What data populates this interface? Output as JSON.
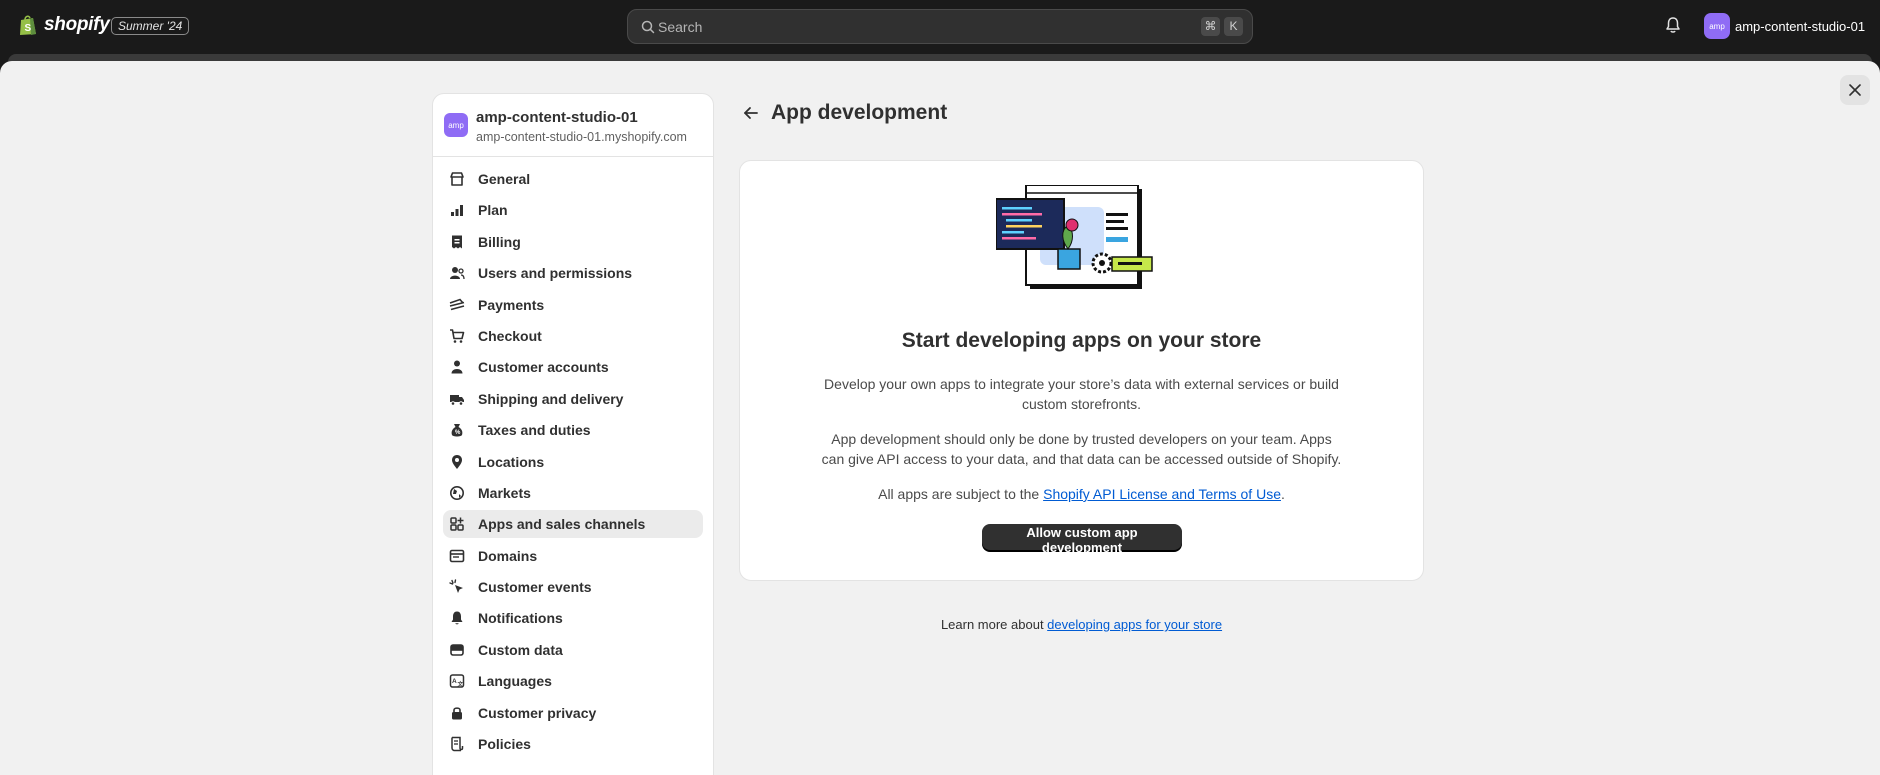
{
  "topbar": {
    "logo_text": "shopify",
    "edition_badge": "Summer '24",
    "search_placeholder": "Search",
    "shortcut_key1": "⌘",
    "shortcut_key2": "K",
    "account_avatar": "amp",
    "account_name": "amp-content-studio-01"
  },
  "sidebar": {
    "store_avatar": "amp",
    "store_name": "amp-content-studio-01",
    "store_domain": "amp-content-studio-01.myshopify.com",
    "items": [
      {
        "label": "General",
        "icon": "store-icon"
      },
      {
        "label": "Plan",
        "icon": "plan-icon"
      },
      {
        "label": "Billing",
        "icon": "billing-icon"
      },
      {
        "label": "Users and permissions",
        "icon": "users-icon"
      },
      {
        "label": "Payments",
        "icon": "payments-icon"
      },
      {
        "label": "Checkout",
        "icon": "cart-icon"
      },
      {
        "label": "Customer accounts",
        "icon": "person-icon"
      },
      {
        "label": "Shipping and delivery",
        "icon": "truck-icon"
      },
      {
        "label": "Taxes and duties",
        "icon": "tax-icon"
      },
      {
        "label": "Locations",
        "icon": "location-pin-icon"
      },
      {
        "label": "Markets",
        "icon": "globe-icon"
      },
      {
        "label": "Apps and sales channels",
        "icon": "apps-icon",
        "active": true
      },
      {
        "label": "Domains",
        "icon": "domain-icon"
      },
      {
        "label": "Customer events",
        "icon": "cursor-icon"
      },
      {
        "label": "Notifications",
        "icon": "bell-icon"
      },
      {
        "label": "Custom data",
        "icon": "database-icon"
      },
      {
        "label": "Languages",
        "icon": "language-icon"
      },
      {
        "label": "Customer privacy",
        "icon": "lock-icon"
      },
      {
        "label": "Policies",
        "icon": "policy-icon"
      }
    ]
  },
  "main": {
    "page_title": "App development",
    "card": {
      "heading": "Start developing apps on your store",
      "paragraph1": "Develop your own apps to integrate your store’s data with external services or build custom storefronts.",
      "paragraph2": "App development should only be done by trusted developers on your team. Apps can give API access to your data, and that data can be accessed outside of Shopify.",
      "terms_prefix": "All apps are subject to the ",
      "terms_link": "Shopify API License and Terms of Use",
      "terms_suffix": ".",
      "button_label": "Allow custom app development"
    },
    "learn_more_prefix": "Learn more about ",
    "learn_more_link": "developing apps for your store"
  },
  "colors": {
    "topbar_bg": "#1a1a1a",
    "modal_bg": "#f1f1f1",
    "avatar": "#8f6cf5",
    "link": "#005bd3",
    "primary_button": "#303030"
  }
}
